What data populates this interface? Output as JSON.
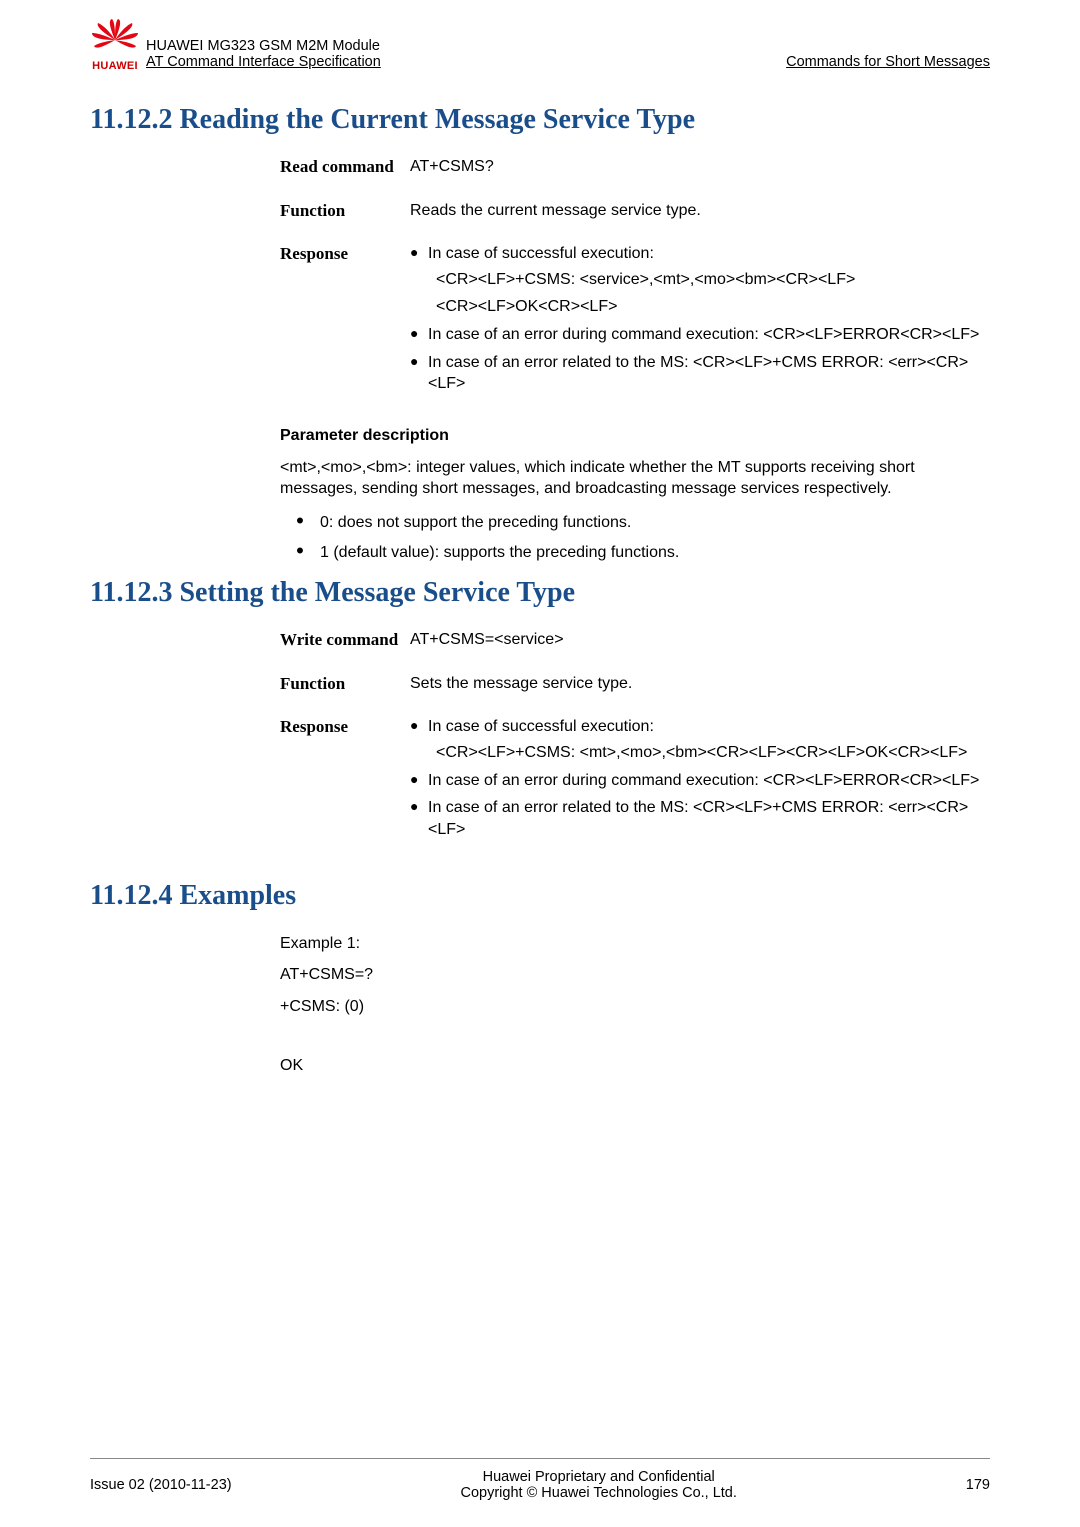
{
  "header": {
    "product": "HUAWEI MG323 GSM M2M Module",
    "subtitle": "AT Command Interface Specification",
    "right": "Commands for Short Messages",
    "brand": "HUAWEI"
  },
  "section1": {
    "title": "11.12.2 Reading the Current Message Service Type",
    "rows": {
      "read_label": "Read command",
      "read_value": "AT+CSMS?",
      "func_label": "Function",
      "func_value": "Reads the current message service type.",
      "resp_label": "Response",
      "b1": "In case of successful execution:",
      "b1_sub1": "<CR><LF>+CSMS: <service>,<mt>,<mo><bm><CR><LF>",
      "b1_sub2": "<CR><LF>OK<CR><LF>",
      "b2": "In case of an error during command execution: <CR><LF>ERROR<CR><LF>",
      "b3": "In case of an error related to the MS: <CR><LF>+CMS ERROR: <err><CR><LF>"
    }
  },
  "param": {
    "heading": "Parameter description",
    "body": "<mt>,<mo>,<bm>: integer values, which indicate whether the MT supports receiving short messages, sending short messages, and broadcasting message services respectively.",
    "li1": "0: does not support the preceding functions.",
    "li2": "1 (default value): supports the preceding functions."
  },
  "section2": {
    "title": "11.12.3 Setting the Message Service Type",
    "rows": {
      "write_label": "Write command",
      "write_value": "AT+CSMS=<service>",
      "func_label": "Function",
      "func_value": "Sets the message service type.",
      "resp_label": "Response",
      "b1": "In case of successful execution:",
      "b1_sub1": "<CR><LF>+CSMS: <mt>,<mo>,<bm><CR><LF><CR><LF>OK<CR><LF>",
      "b2": "In case of an error during command execution: <CR><LF>ERROR<CR><LF>",
      "b3": "In case of an error related to the MS: <CR><LF>+CMS ERROR: <err><CR><LF>"
    }
  },
  "section3": {
    "title": "11.12.4 Examples",
    "ex_label": "Example 1:",
    "ex_cmd": "AT+CSMS=?",
    "ex_resp": "+CSMS: (0)",
    "ex_ok": "OK"
  },
  "footer": {
    "left": "Issue 02 (2010-11-23)",
    "c1": "Huawei Proprietary and Confidential",
    "c2": "Copyright © Huawei Technologies Co., Ltd.",
    "right": "179"
  }
}
